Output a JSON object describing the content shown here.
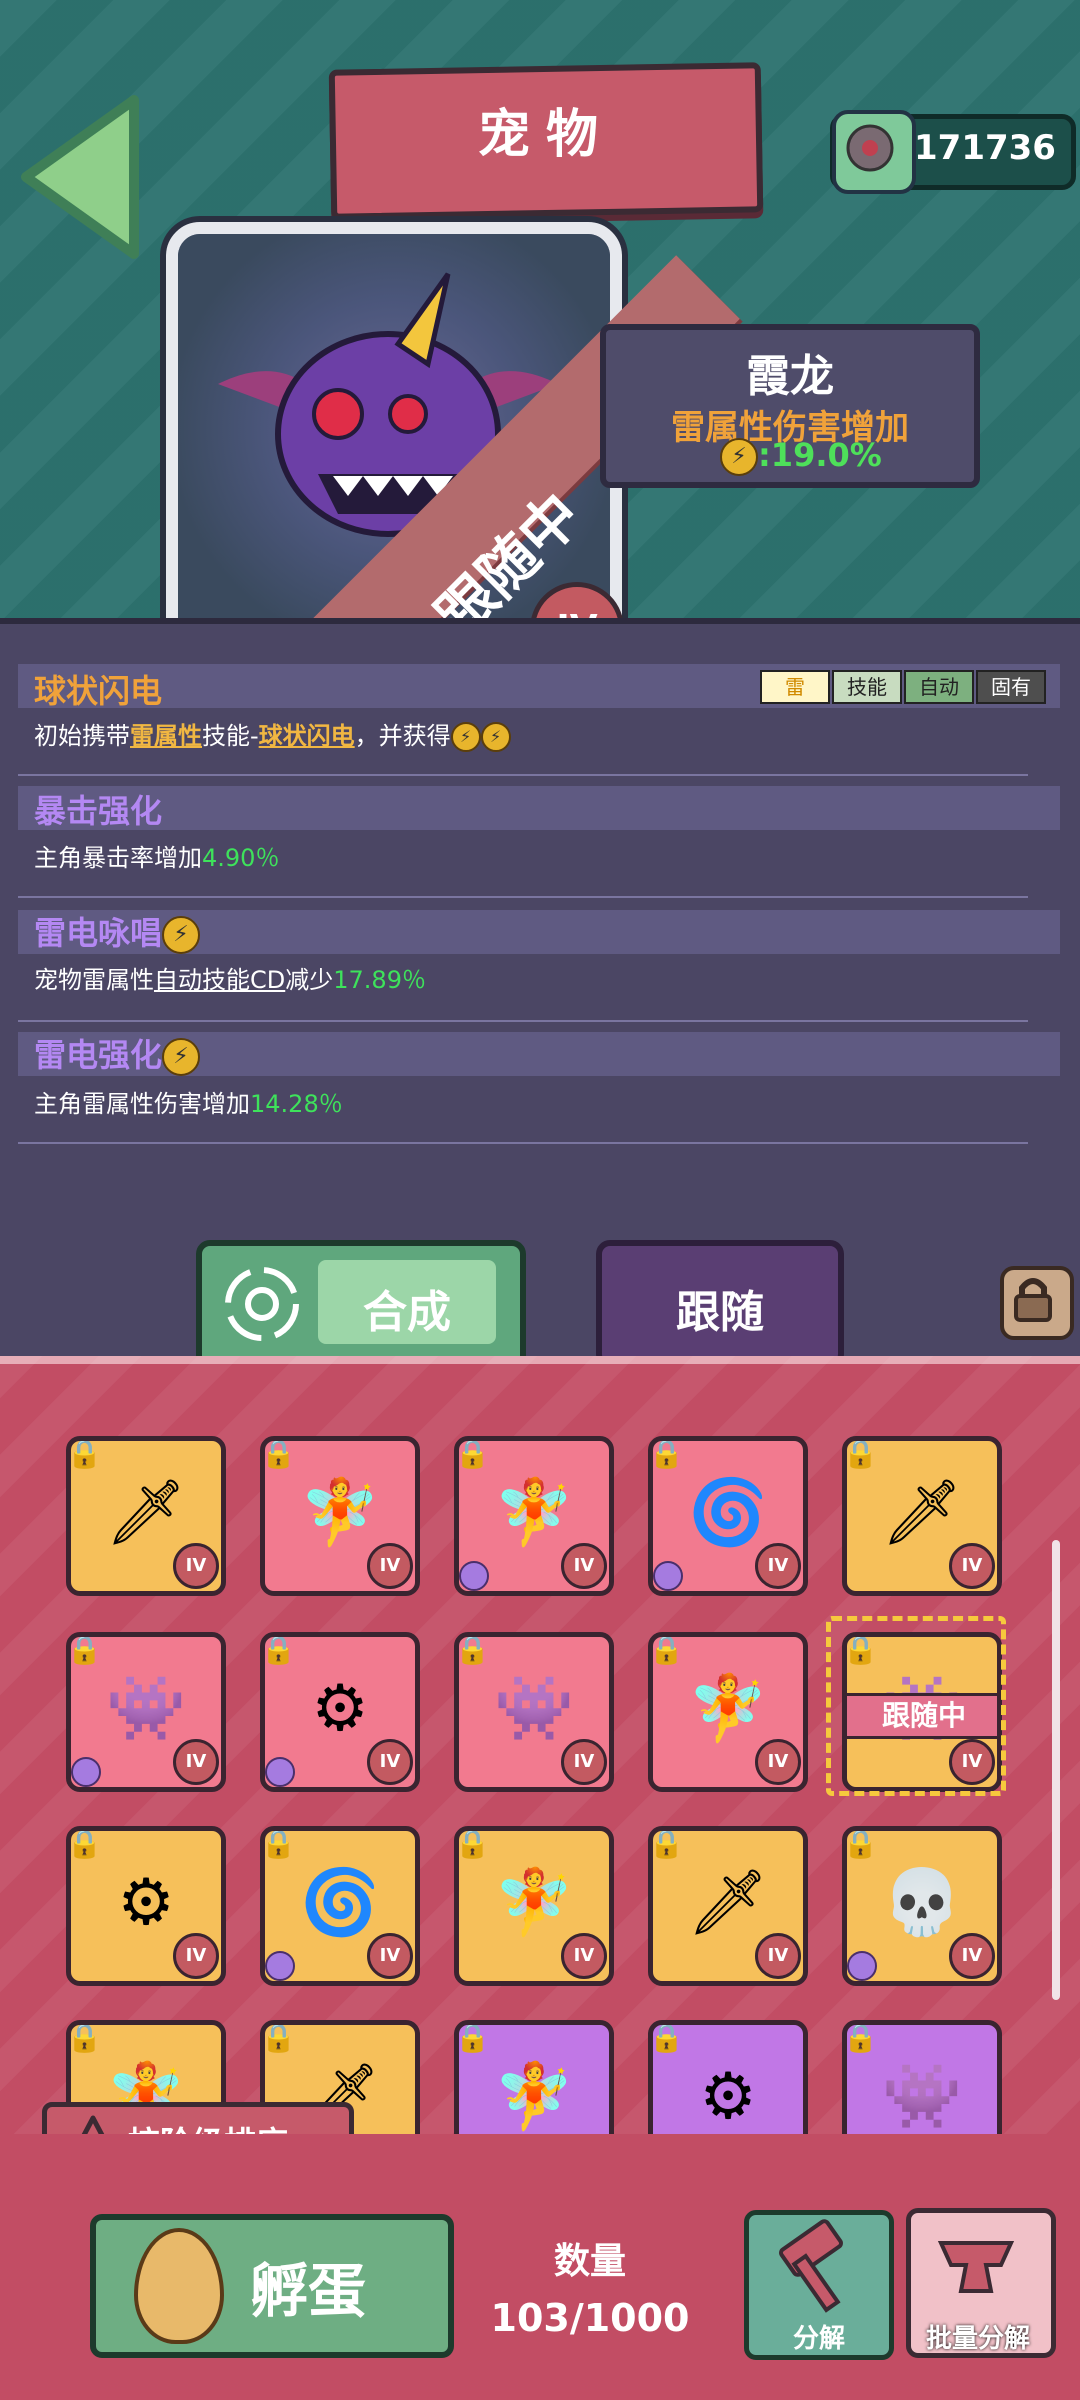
{
  "header": {
    "title": "宠物",
    "currency": "171736"
  },
  "pet": {
    "name": "霞龙",
    "attribute": "雷属性伤害增加",
    "bonus": ":19.0%",
    "status": "跟随中",
    "rank": "IV"
  },
  "skills": [
    {
      "title": "球状闪电",
      "desc_a": "初始携带",
      "desc_link1": "雷属性",
      "desc_b": "技能-",
      "desc_link2": "球状闪电",
      "desc_c": "，并获得",
      "tags": [
        "雷",
        "技能",
        "自动",
        "固有"
      ]
    },
    {
      "title": "暴击强化",
      "desc": "主角暴击率增加",
      "value": "4.90％"
    },
    {
      "title": "雷电咏唱",
      "desc_a": "宠物雷属性",
      "desc_link": "自动技能CD",
      "desc_b": "减少",
      "value": "17.89％"
    },
    {
      "title": "雷电强化",
      "desc": "主角雷属性伤害增加",
      "value": "14.28％"
    }
  ],
  "tabs": {
    "merge": "合成",
    "follow": "跟随"
  },
  "inventory": {
    "level_label": "IV",
    "following_badge": "跟随中",
    "items": [
      {
        "icon": "sword",
        "bg": "gold"
      },
      {
        "icon": "fairy",
        "bg": "pink"
      },
      {
        "icon": "fairy",
        "bg": "pink"
      },
      {
        "icon": "spring-creature",
        "bg": "pink"
      },
      {
        "icon": "sword",
        "bg": "gold"
      },
      {
        "icon": "purple-dragon",
        "bg": "pink"
      },
      {
        "icon": "drone",
        "bg": "pink"
      },
      {
        "icon": "purple-dragon",
        "bg": "pink"
      },
      {
        "icon": "fairy",
        "bg": "pink"
      },
      {
        "icon": "purple-dragon",
        "bg": "gold"
      },
      {
        "icon": "drone",
        "bg": "gold"
      },
      {
        "icon": "spring-creature",
        "bg": "gold"
      },
      {
        "icon": "fairy",
        "bg": "gold"
      },
      {
        "icon": "sword",
        "bg": "gold"
      },
      {
        "icon": "skull",
        "bg": "gold"
      },
      {
        "icon": "fairy",
        "bg": "gold"
      },
      {
        "icon": "sword",
        "bg": "gold"
      },
      {
        "icon": "fairy",
        "bg": "purple"
      },
      {
        "icon": "drone",
        "bg": "purple"
      },
      {
        "icon": "purple-dragon",
        "bg": "purple"
      }
    ]
  },
  "sort_button": "按阶级排序",
  "bottom": {
    "hatch": "孵蛋",
    "count_label": "数量",
    "count_value": "103/1000",
    "decompose": "分解",
    "batch_decompose": "批量分解"
  }
}
